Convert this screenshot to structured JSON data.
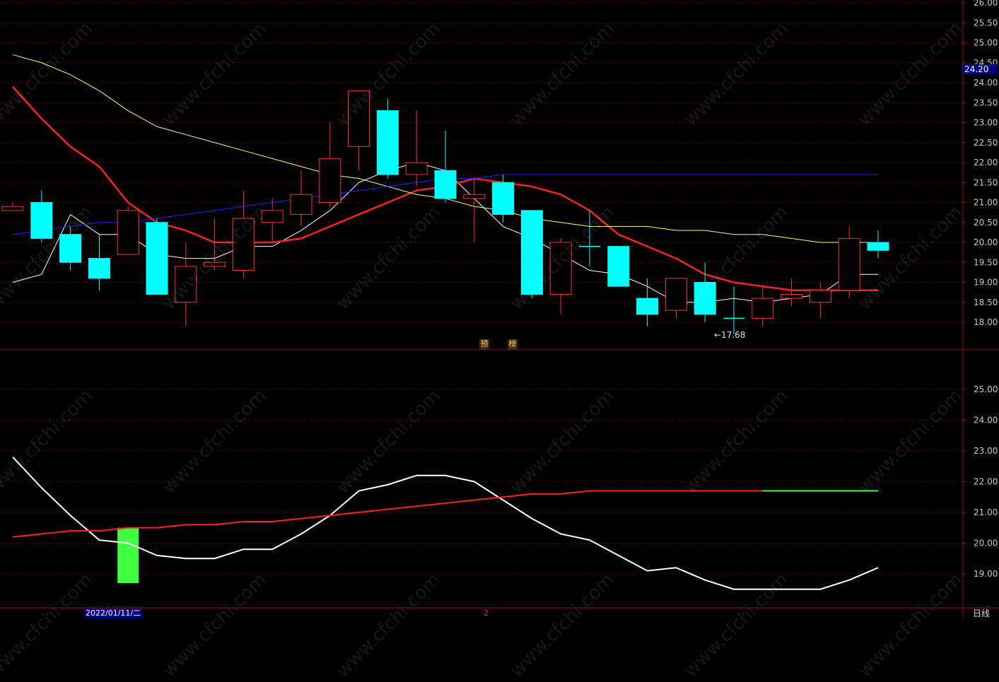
{
  "chart_data": [
    {
      "type": "candlestick",
      "panel": "price",
      "yticks": [
        "18.00",
        "18.50",
        "19.00",
        "19.50",
        "20.00",
        "20.50",
        "21.00",
        "21.50",
        "22.00",
        "22.50",
        "23.00",
        "23.50",
        "24.00",
        "24.50",
        "25.00",
        "25.50",
        "26.00"
      ],
      "ylim": [
        17.3,
        26.0
      ],
      "current_price": "24.20",
      "low_marker": "←17.68",
      "badges": [
        "预",
        "榜"
      ],
      "candles": [
        {
          "o": 20.9,
          "h": 21.0,
          "l": 20.9,
          "c": 20.8,
          "color": "up"
        },
        {
          "o": 21.0,
          "h": 21.3,
          "l": 20.0,
          "c": 20.1,
          "color": "down"
        },
        {
          "o": 20.2,
          "h": 20.4,
          "l": 19.3,
          "c": 19.5,
          "color": "down"
        },
        {
          "o": 19.6,
          "h": 20.2,
          "l": 18.8,
          "c": 19.1,
          "color": "down"
        },
        {
          "o": 19.7,
          "h": 20.9,
          "l": 19.7,
          "c": 20.8,
          "color": "up"
        },
        {
          "o": 20.5,
          "h": 20.6,
          "l": 18.7,
          "c": 18.7,
          "color": "down"
        },
        {
          "o": 18.5,
          "h": 20.0,
          "l": 17.9,
          "c": 19.4,
          "color": "up"
        },
        {
          "o": 19.4,
          "h": 20.6,
          "l": 19.3,
          "c": 19.5,
          "color": "up"
        },
        {
          "o": 19.3,
          "h": 21.3,
          "l": 19.1,
          "c": 20.6,
          "color": "up"
        },
        {
          "o": 20.5,
          "h": 21.1,
          "l": 20.0,
          "c": 20.8,
          "color": "up"
        },
        {
          "o": 20.7,
          "h": 21.8,
          "l": 20.4,
          "c": 21.2,
          "color": "up"
        },
        {
          "o": 21.0,
          "h": 23.0,
          "l": 20.9,
          "c": 22.1,
          "color": "up"
        },
        {
          "o": 22.4,
          "h": 23.8,
          "l": 21.8,
          "c": 23.8,
          "color": "up"
        },
        {
          "o": 23.3,
          "h": 23.6,
          "l": 21.6,
          "c": 21.7,
          "color": "down"
        },
        {
          "o": 22.0,
          "h": 23.3,
          "l": 21.4,
          "c": 21.7,
          "color": "up"
        },
        {
          "o": 21.8,
          "h": 22.8,
          "l": 21.0,
          "c": 21.1,
          "color": "down"
        },
        {
          "o": 21.1,
          "h": 21.6,
          "l": 20.0,
          "c": 21.2,
          "color": "up"
        },
        {
          "o": 21.5,
          "h": 21.7,
          "l": 20.5,
          "c": 20.7,
          "color": "down"
        },
        {
          "o": 20.8,
          "h": 20.8,
          "l": 18.6,
          "c": 18.7,
          "color": "down"
        },
        {
          "o": 18.7,
          "h": 20.1,
          "l": 18.2,
          "c": 20.0,
          "color": "up"
        },
        {
          "o": 19.9,
          "h": 20.8,
          "l": 19.4,
          "c": 19.9,
          "color": "doji"
        },
        {
          "o": 19.9,
          "h": 19.9,
          "l": 18.9,
          "c": 18.9,
          "color": "down"
        },
        {
          "o": 18.6,
          "h": 19.1,
          "l": 17.9,
          "c": 18.2,
          "color": "down"
        },
        {
          "o": 18.3,
          "h": 19.1,
          "l": 18.1,
          "c": 19.1,
          "color": "up"
        },
        {
          "o": 19.0,
          "h": 19.5,
          "l": 18.0,
          "c": 18.2,
          "color": "down"
        },
        {
          "o": 18.1,
          "h": 18.9,
          "l": 17.7,
          "c": 18.1,
          "color": "doji"
        },
        {
          "o": 18.1,
          "h": 18.9,
          "l": 17.9,
          "c": 18.6,
          "color": "up"
        },
        {
          "o": 18.6,
          "h": 19.1,
          "l": 18.4,
          "c": 18.7,
          "color": "up"
        },
        {
          "o": 18.5,
          "h": 19.0,
          "l": 18.1,
          "c": 18.8,
          "color": "up"
        },
        {
          "o": 18.8,
          "h": 20.4,
          "l": 18.6,
          "c": 20.1,
          "color": "up"
        },
        {
          "o": 20.0,
          "h": 20.3,
          "l": 19.6,
          "c": 19.8,
          "color": "down"
        }
      ],
      "series": [
        {
          "color": "#ffffff",
          "values": [
            19.0,
            19.2,
            20.7,
            20.2,
            20.2,
            19.7,
            19.6,
            19.6,
            19.9,
            19.9,
            20.3,
            20.8,
            21.5,
            21.8,
            22.0,
            21.8,
            21.1,
            20.4,
            20.1,
            19.7,
            19.3,
            19.2,
            18.9,
            18.5,
            18.5,
            18.6,
            18.5,
            18.6,
            18.7,
            19.2,
            19.2
          ]
        },
        {
          "color": "#ff2020",
          "values": [
            23.9,
            23.1,
            22.4,
            21.9,
            21.0,
            20.5,
            20.3,
            20.0,
            20.0,
            20.0,
            20.1,
            20.4,
            20.7,
            21.0,
            21.3,
            21.4,
            21.6,
            21.5,
            21.4,
            21.2,
            20.8,
            20.2,
            19.9,
            19.6,
            19.2,
            19.0,
            18.9,
            18.8,
            18.8,
            18.8,
            18.8
          ]
        },
        {
          "color": "#ffff60",
          "values": [
            24.7,
            24.5,
            24.2,
            23.8,
            23.3,
            22.9,
            22.7,
            22.5,
            22.3,
            22.1,
            21.9,
            21.7,
            21.6,
            21.4,
            21.2,
            21.1,
            20.9,
            20.8,
            20.6,
            20.5,
            20.4,
            20.4,
            20.4,
            20.3,
            20.3,
            20.2,
            20.2,
            20.1,
            20.0,
            20.0,
            20.0
          ]
        },
        {
          "color": "#2020ff",
          "values": [
            20.2,
            20.3,
            20.4,
            20.5,
            20.5,
            20.6,
            20.7,
            20.8,
            20.9,
            21.0,
            21.1,
            21.2,
            21.3,
            21.4,
            21.5,
            21.6,
            21.6,
            21.7,
            21.7,
            21.7,
            21.7,
            21.7,
            21.7,
            21.7,
            21.7,
            21.7,
            21.7,
            21.7,
            21.7,
            21.7,
            21.7
          ]
        }
      ]
    },
    {
      "type": "line",
      "panel": "indicator",
      "yticks": [
        "19.00",
        "20.00",
        "21.00",
        "22.00",
        "23.00",
        "24.00",
        "25.00"
      ],
      "ylim": [
        18.0,
        26.0
      ],
      "series": [
        {
          "color": "#ffffff",
          "values": [
            22.8,
            21.8,
            20.9,
            20.1,
            20.0,
            19.6,
            19.5,
            19.5,
            19.8,
            19.8,
            20.3,
            20.9,
            21.7,
            21.9,
            22.2,
            22.2,
            22.0,
            21.4,
            20.8,
            20.3,
            20.1,
            19.6,
            19.1,
            19.2,
            18.8,
            18.5,
            18.5,
            18.5,
            18.5,
            18.8,
            19.2
          ]
        },
        {
          "color": "#ff2020",
          "values": [
            20.2,
            20.3,
            20.4,
            20.4,
            20.5,
            20.5,
            20.6,
            20.6,
            20.7,
            20.7,
            20.8,
            20.9,
            21.0,
            21.1,
            21.2,
            21.3,
            21.4,
            21.5,
            21.6,
            21.6,
            21.7,
            21.7,
            21.7,
            21.7,
            21.7,
            21.7,
            21.7,
            21.7,
            21.7,
            21.7,
            21.7
          ]
        },
        {
          "color": "#40ff40",
          "values": [
            null,
            null,
            null,
            null,
            null,
            null,
            null,
            null,
            null,
            null,
            null,
            null,
            null,
            null,
            null,
            null,
            null,
            null,
            null,
            null,
            null,
            null,
            null,
            null,
            null,
            null,
            21.7,
            21.7,
            21.7,
            21.7,
            21.7
          ]
        }
      ],
      "bars": [
        {
          "index": 4,
          "top": 20.5,
          "bottom": 18.7,
          "color": "#40ff40"
        }
      ]
    }
  ],
  "footer": {
    "date": "2022/01/11/二",
    "cursor_index": "2",
    "period": "日线"
  },
  "watermark": "www.cfchi.com",
  "colors": {
    "up": "#ff3030",
    "down": "#00ffff",
    "grid": "#6a0000",
    "axis": "#aa0000"
  }
}
